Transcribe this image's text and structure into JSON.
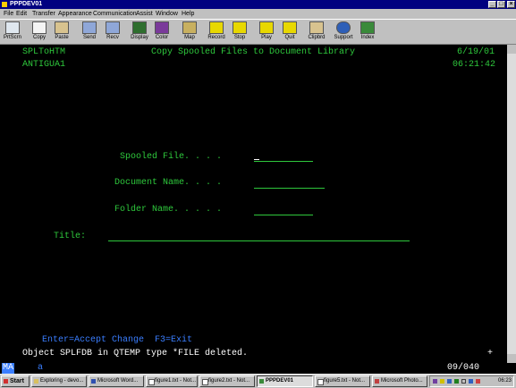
{
  "window": {
    "title": "PPPDEV01",
    "min_glyph": "_",
    "max_glyph": "□",
    "close_glyph": "×"
  },
  "menu": [
    "File",
    "Edit",
    "Transfer",
    "Appearance",
    "Communication",
    "Assist",
    "Window",
    "Help"
  ],
  "toolbar": [
    "PrtScrn",
    "Copy",
    "Paste",
    "Send",
    "Recv",
    "Display",
    "Color",
    "Map",
    "Record",
    "Stop",
    "Play",
    "Quit",
    "Clipbrd",
    "Support",
    "Index"
  ],
  "screen": {
    "program": "SPLToHTM",
    "system": "ANTIGUA1",
    "heading": "Copy Spooled Files to Document Library",
    "date": "6/19/01",
    "time": "06:21:42",
    "fields": {
      "spooled_file": "Spooled File. . . .",
      "document_name": "Document Name. . . .",
      "folder_name": "Folder Name. . . . .",
      "title": "Title:"
    },
    "function_keys": "Enter=Accept Change  F3=Exit",
    "message": "Object SPLFDB in QTEMP type *FILE deleted.",
    "plus": "+"
  },
  "status": {
    "mode": "MA",
    "indicator": "a",
    "cursor_pos": "09/040"
  },
  "taskbar": {
    "start": "Start",
    "items": [
      "Exploring - devo...",
      "Microsoft Word...",
      "figure1.txt - Not...",
      "figure2.txt - Not...",
      "PPPDEV01",
      "figure5.txt - Not...",
      "Microsoft Photo..."
    ],
    "clock": "06:23"
  }
}
